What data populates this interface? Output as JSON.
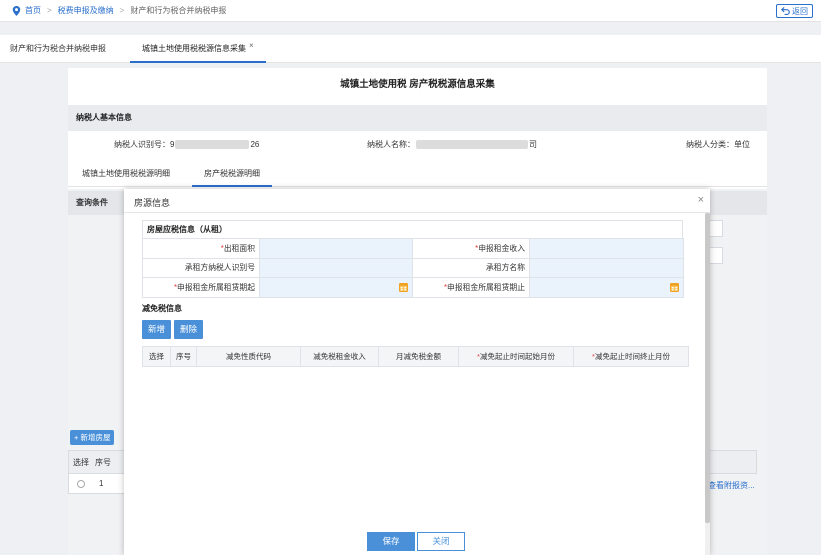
{
  "breadcrumb": {
    "home": "首页",
    "items": [
      "税费申报及缴纳",
      "财产和行为税合并纳税申报"
    ]
  },
  "back_label": "返回",
  "tabs": [
    {
      "label": "财产和行为税合并纳税申报",
      "active": false
    },
    {
      "label": "城镇土地使用税税源信息采集",
      "active": true,
      "close": "×"
    }
  ],
  "page": {
    "title": "城镇土地使用税 房产税税源信息采集",
    "section_basic": "纳税人基本信息",
    "taxpayer_id_label": "纳税人识别号：",
    "taxpayer_id_visible_start": "9",
    "taxpayer_id_visible_end": "26",
    "taxpayer_name_label": "纳税人名称：",
    "taxpayer_name_visible_start": "",
    "taxpayer_name_visible_end": "司",
    "taxpayer_type_label": "纳税人分类：",
    "taxpayer_type_value": "单位",
    "subtabs": [
      {
        "label": "城镇土地使用税税源明细",
        "active": false
      },
      {
        "label": "房产税税源明细",
        "active": true
      }
    ],
    "query_conditions": "查询条件",
    "add_house_btn": "+ 新增房屋",
    "under_headers": [
      "选择",
      "序号"
    ],
    "under_row_no": "1",
    "under_link": "查看附报资..."
  },
  "modal": {
    "title": "房源信息",
    "close": "×",
    "rent_section_title": "房屋应税信息（从租）",
    "fields": [
      {
        "label": "出租面积",
        "required": true,
        "value": ""
      },
      {
        "label": "申报租金收入",
        "required": true,
        "value": ""
      },
      {
        "label": "承租方纳税人识别号",
        "required": false,
        "value": ""
      },
      {
        "label": "承租方名称",
        "required": false,
        "value": ""
      },
      {
        "label": "申报租金所属租赁期起",
        "required": true,
        "value": ""
      },
      {
        "label": "申报租金所属租赁期止",
        "required": true,
        "value": ""
      }
    ],
    "relief_title": "减免税信息",
    "add_btn": "新增",
    "delete_btn": "删除",
    "relief_headers": [
      {
        "label": "选择",
        "required": false
      },
      {
        "label": "序号",
        "required": false
      },
      {
        "label": "减免性质代码",
        "required": false
      },
      {
        "label": "减免税租金收入",
        "required": false
      },
      {
        "label": "月减免税金额",
        "required": false
      },
      {
        "label": "减免起止时间起始月份",
        "required": true
      },
      {
        "label": "减免起止时间终止月份",
        "required": true
      }
    ],
    "save_btn": "保存",
    "close_btn": "关闭"
  },
  "colors": {
    "accent": "#4a90d9",
    "link": "#2b6fcc",
    "required": "#e23b3b",
    "calendar": "#f0a020"
  }
}
